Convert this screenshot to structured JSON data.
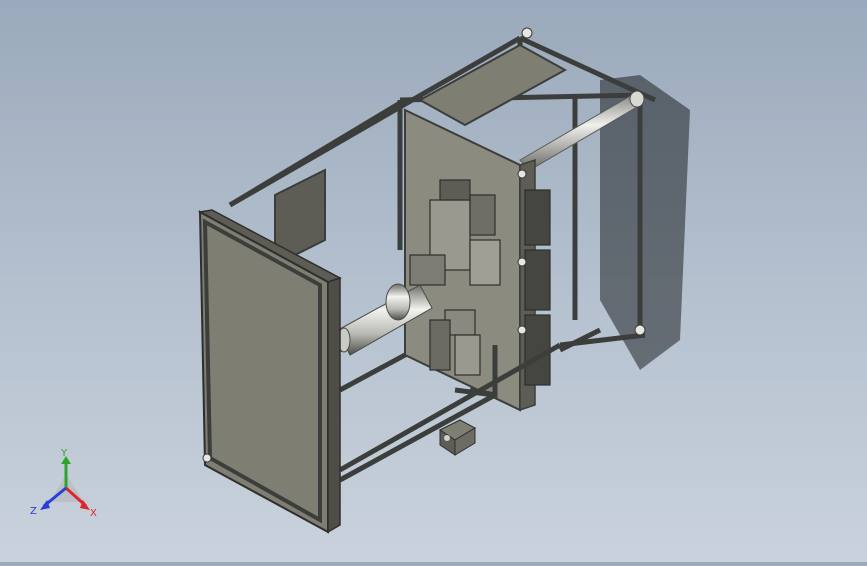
{
  "viewport": {
    "background_top": "#9aa9bb",
    "background_bottom": "#c9d2dc",
    "model_colors": {
      "frame": "#3c3e3c",
      "panel": "#7f7e73",
      "panel_face": "#8c8b80",
      "panel_dark": "#5d5c55",
      "shaft": "#d6d6d2",
      "shadow": "#1f2326"
    }
  },
  "triad": {
    "x_label": "X",
    "y_label": "Y",
    "z_label": "Z",
    "x_color": "#e0262b",
    "y_color": "#2ca52c",
    "z_color": "#2a3fd6"
  }
}
